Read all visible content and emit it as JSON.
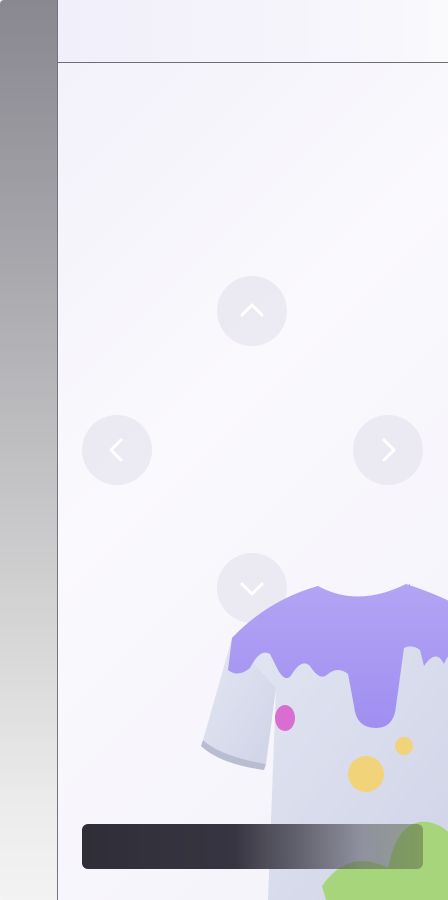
{
  "sidebar": {},
  "top_panel": {
    "title": ""
  },
  "navigation": {
    "up_icon": "chevron-up-icon",
    "left_icon": "chevron-left-icon",
    "right_icon": "chevron-right-icon",
    "down_icon": "chevron-down-icon"
  },
  "product": {
    "image": "tshirt-image"
  },
  "bottom_bar": {
    "label": ""
  },
  "colors": {
    "accent": "#a99af0",
    "sidebar_top": "#89878f",
    "bar_dark": "#2f2e38",
    "button_bg": "#e9e8f1"
  }
}
